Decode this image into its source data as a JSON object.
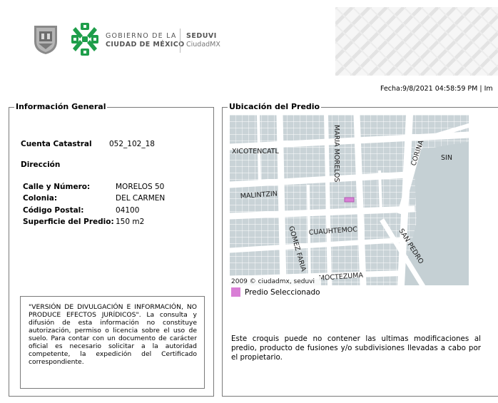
{
  "header": {
    "gov_line1": "GOBIERNO DE LA",
    "gov_line2": "CIUDAD DE MÉXICO",
    "agency_name": "SEDUVI",
    "agency_sub": "CiudadMX",
    "timestamp": "Fecha:9/8/2021 04:58:59 PM | Im"
  },
  "colors": {
    "brand_green": "#1e9e4a",
    "selected_parcel": "#d97fd6",
    "map_street": "#ffffff",
    "map_block": "#c9d3d7"
  },
  "general": {
    "legend": "Información General",
    "cuenta_label": "Cuenta Catastral",
    "cuenta_value": "052_102_18",
    "direccion_label": "Dirección",
    "calle_label": "Calle y Número:",
    "calle_value": "MORELOS 50",
    "colonia_label": "Colonia:",
    "colonia_value": "DEL CARMEN",
    "cp_label": "Código Postal:",
    "cp_value": "04100",
    "superficie_label": "Superficie del Predio:",
    "superficie_value": "150 m2",
    "disclaimer": "\"VERSIÓN DE DIVULGACIÓN E INFORMACIÓN, NO PRODUCE EFECTOS JURÍDICOS\". La consulta y difusión de esta información no constituye autorización, permiso o licencia sobre el uso de suelo. Para contar con un documento de carácter oficial es necesario solicitar a la autoridad competente, la expedición del Certificado correspondiente."
  },
  "ubicacion": {
    "legend": "Ubicación del Predio",
    "streets": {
      "xicotencatl": "XICOTENCATL",
      "maria_morelos": "MARIA MORELOS",
      "sin": "SIN",
      "corina": "CORINA",
      "malintzin": "MALINTZIN",
      "cuauhtemoc": "CUAUHTEMOC",
      "gomez_farias": "GOMEZ FARIA",
      "san_pedro": "SAN PEDRO",
      "moctezuma": "MOCTEZUMA"
    },
    "map_credit": "2009 © ciudadmx, seduvi",
    "legend_label": "Predio Seleccionado",
    "note": "Este croquis puede no contener las ultimas modificaciones al predio, producto de fusiones y/o subdivisiones llevadas a cabo por el propietario."
  }
}
